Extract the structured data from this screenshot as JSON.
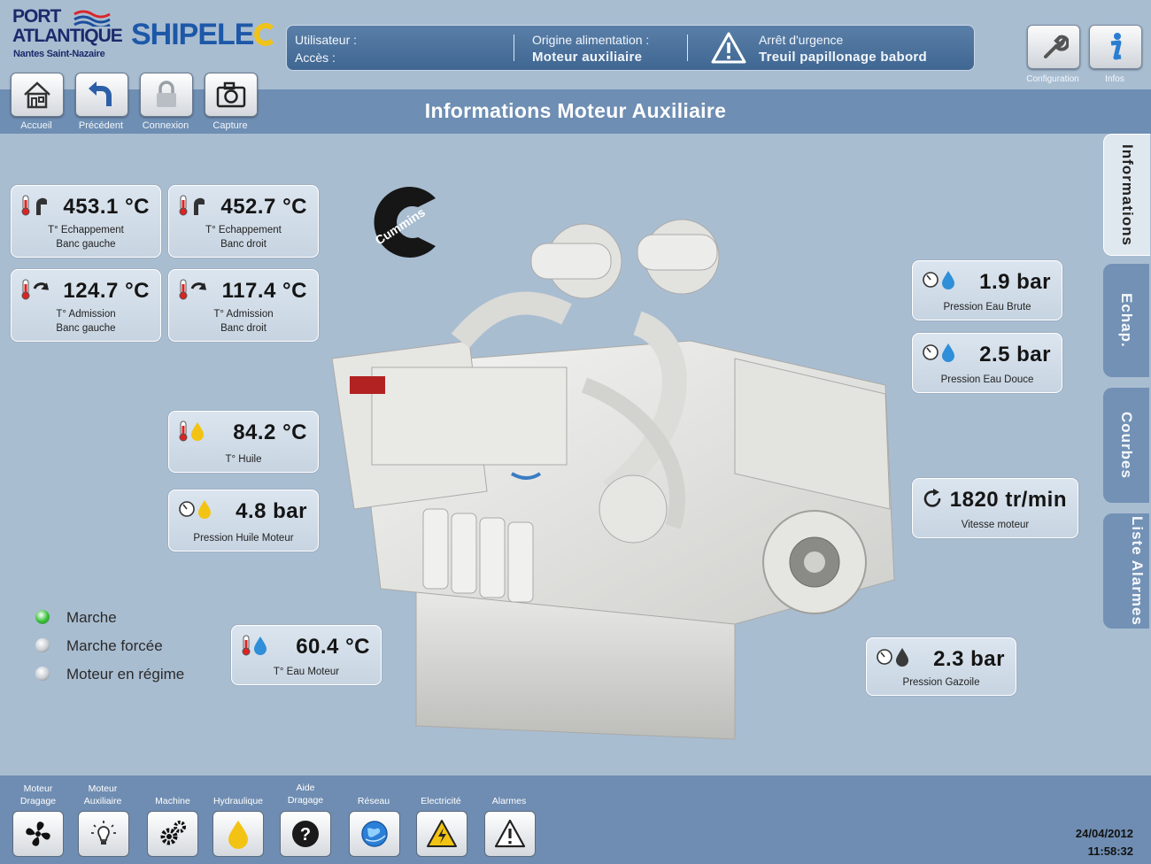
{
  "logos": {
    "port_line1": "PORT",
    "port_line2": "ATLANTIQUE",
    "port_line3": "Nantes Saint-Nazaire",
    "shipelec": "SHIPELE",
    "cummins": "Cummins"
  },
  "status": {
    "user_label": "Utilisateur :",
    "access_label": "Accès :",
    "power_label": "Origine alimentation :",
    "power_value": "Moteur auxiliaire",
    "alarm_label": "Arrêt d'urgence",
    "alarm_value": "Treuil papillonage babord"
  },
  "top_right": {
    "config_label": "Configuration",
    "infos_label": "Infos"
  },
  "toolbar": [
    {
      "label": "Accueil"
    },
    {
      "label": "Précédent"
    },
    {
      "label": "Connexion"
    },
    {
      "label": "Capture"
    }
  ],
  "title": "Informations Moteur Auxiliaire",
  "cards": {
    "exh_left": {
      "value": "453.1 °C",
      "label1": "T° Echappement",
      "label2": "Banc gauche"
    },
    "exh_right": {
      "value": "452.7 °C",
      "label1": "T° Echappement",
      "label2": "Banc droit"
    },
    "adm_left": {
      "value": "124.7 °C",
      "label1": "T° Admission",
      "label2": "Banc gauche"
    },
    "adm_right": {
      "value": "117.4 °C",
      "label1": "T° Admission",
      "label2": "Banc droit"
    },
    "oil_temp": {
      "value": "84.2 °C",
      "label1": "T° Huile"
    },
    "oil_press": {
      "value": "4.8 bar",
      "label1": "Pression Huile Moteur"
    },
    "water_temp": {
      "value": "60.4 °C",
      "label1": "T° Eau Moteur"
    },
    "raw_water": {
      "value": "1.9 bar",
      "label1": "Pression Eau Brute"
    },
    "fresh_water": {
      "value": "2.5 bar",
      "label1": "Pression Eau Douce"
    },
    "speed": {
      "value": "1820 tr/min",
      "label1": "Vitesse moteur"
    },
    "diesel": {
      "value": "2.3 bar",
      "label1": "Pression Gazoile"
    }
  },
  "legend": [
    {
      "label": "Marche",
      "color": "#2fbf2f"
    },
    {
      "label": "Marche forcée",
      "color": "#c8cdd2"
    },
    {
      "label": "Moteur en régime",
      "color": "#c8cdd2"
    }
  ],
  "tabs": [
    {
      "label": "Informations"
    },
    {
      "label": "Echap."
    },
    {
      "label": "Courbes"
    },
    {
      "label": "Liste Alarmes"
    }
  ],
  "nav": [
    {
      "label1": "Moteur",
      "label2": "Dragage",
      "icon": "fan-icon"
    },
    {
      "label1": "Moteur",
      "label2": "Auxiliaire",
      "icon": "bulb-icon"
    },
    {
      "label1": "Machine",
      "label2": "",
      "icon": "gears-icon"
    },
    {
      "label1": "Hydraulique",
      "label2": "",
      "icon": "drop-icon"
    },
    {
      "label1": "Aide",
      "label2": "Dragage",
      "icon": "help-icon"
    },
    {
      "label1": "Réseau",
      "label2": "",
      "icon": "globe-icon"
    },
    {
      "label1": "Electricité",
      "label2": "",
      "icon": "electric-icon"
    },
    {
      "label1": "Alarmes",
      "label2": "",
      "icon": "alarm-icon"
    }
  ],
  "datetime": {
    "date": "24/04/2012",
    "time": "11:58:32"
  },
  "colors": {
    "accent": "#6e8eb3",
    "background": "#a9bdd1",
    "status_panel": "#4a719b"
  }
}
